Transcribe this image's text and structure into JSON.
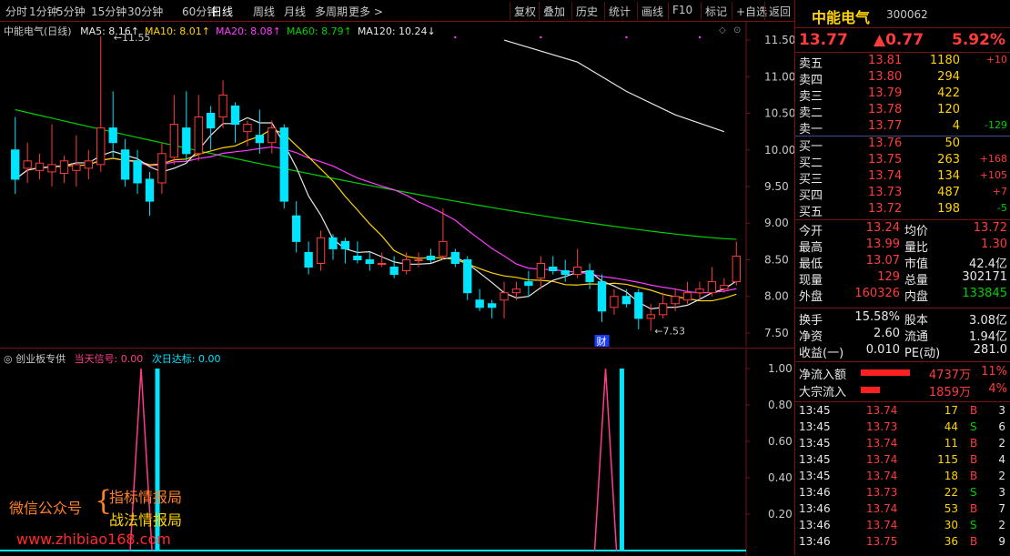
{
  "toolbar": {
    "periods": [
      "分时",
      "1分钟",
      "5分钟",
      "15分钟",
      "30分钟",
      "60分钟",
      "日线",
      "周线",
      "月线",
      "多周期",
      "更多 >"
    ],
    "active_period": "日线",
    "buttons": [
      "复权",
      "叠加",
      "历史",
      "统计",
      "画线",
      "F10",
      "标记",
      "+自选",
      "返回"
    ]
  },
  "chart": {
    "stock_title": "中能电气(日线)",
    "ma": [
      {
        "label": "MA5: 8.16",
        "arrow": "↑",
        "color": "#e8e8e8"
      },
      {
        "label": "MA10: 8.01",
        "arrow": "↑",
        "color": "#ffd400"
      },
      {
        "label": "MA20: 8.08",
        "arrow": "↑",
        "color": "#ff3cff"
      },
      {
        "label": "MA60: 8.79",
        "arrow": "↑",
        "color": "#00d000"
      },
      {
        "label": "MA120: 10.24",
        "arrow": "↓",
        "color": "#e8e8e8"
      }
    ],
    "price_axis": [
      "11.50",
      "11.00",
      "10.50",
      "10.00",
      "9.50",
      "9.00",
      "8.50",
      "8.00",
      "7.50"
    ],
    "high_mark": "11.55",
    "low_mark": "7.53",
    "event_mark": "财",
    "colors": {
      "up": "#ff3b3b",
      "down": "#00e5ff",
      "ma5": "#e8e8e8",
      "ma10": "#ffd400",
      "ma20": "#ff3cff",
      "ma60": "#00d000",
      "ma120": "#e8e8e8",
      "border": "#7a1010"
    }
  },
  "chart_data": {
    "type": "candlestick",
    "ylim": [
      7.4,
      11.6
    ],
    "candles": [
      [
        10.0,
        9.6,
        10.45,
        9.4
      ],
      [
        9.75,
        9.85,
        10.1,
        9.55
      ],
      [
        9.72,
        9.82,
        9.95,
        9.6
      ],
      [
        9.7,
        9.8,
        10.35,
        9.5
      ],
      [
        9.68,
        9.85,
        9.92,
        9.55
      ],
      [
        9.72,
        9.8,
        10.2,
        9.5
      ],
      [
        9.75,
        9.85,
        10.0,
        9.6
      ],
      [
        9.8,
        10.3,
        11.55,
        9.7
      ],
      [
        10.3,
        10.1,
        10.8,
        9.9
      ],
      [
        10.0,
        9.6,
        10.15,
        9.5
      ],
      [
        9.85,
        9.55,
        10.0,
        9.4
      ],
      [
        9.6,
        9.3,
        9.7,
        9.1
      ],
      [
        9.55,
        9.95,
        10.1,
        9.4
      ],
      [
        9.9,
        10.35,
        10.75,
        9.8
      ],
      [
        10.3,
        9.95,
        10.8,
        9.85
      ],
      [
        9.95,
        10.45,
        10.75,
        9.85
      ],
      [
        10.5,
        10.3,
        10.6,
        10.0
      ],
      [
        10.45,
        10.75,
        10.95,
        10.3
      ],
      [
        10.6,
        10.35,
        10.65,
        10.1
      ],
      [
        10.25,
        10.35,
        10.4,
        10.05
      ],
      [
        10.2,
        10.1,
        10.55,
        9.95
      ],
      [
        10.1,
        10.3,
        10.4,
        9.95
      ],
      [
        10.3,
        9.3,
        10.35,
        9.2
      ],
      [
        9.1,
        8.75,
        9.3,
        8.6
      ],
      [
        8.6,
        8.4,
        8.75,
        8.3
      ],
      [
        8.45,
        8.8,
        8.9,
        8.35
      ],
      [
        8.8,
        8.65,
        8.85,
        8.5
      ],
      [
        8.75,
        8.65,
        8.8,
        8.45
      ],
      [
        8.55,
        8.5,
        8.75,
        8.45
      ],
      [
        8.5,
        8.45,
        8.6,
        8.35
      ],
      [
        8.45,
        8.45,
        8.6,
        8.4
      ],
      [
        8.4,
        8.3,
        8.55,
        8.25
      ],
      [
        8.35,
        8.5,
        8.6,
        8.3
      ],
      [
        8.5,
        8.5,
        8.6,
        8.4
      ],
      [
        8.55,
        8.5,
        8.65,
        8.45
      ],
      [
        8.55,
        8.75,
        9.2,
        8.5
      ],
      [
        8.6,
        8.45,
        8.65,
        8.4
      ],
      [
        8.5,
        8.05,
        8.55,
        7.95
      ],
      [
        7.95,
        7.85,
        8.1,
        7.8
      ],
      [
        7.9,
        7.85,
        7.95,
        7.7
      ],
      [
        7.95,
        8.05,
        8.2,
        7.7
      ],
      [
        8.05,
        8.1,
        8.2,
        7.95
      ],
      [
        8.2,
        8.15,
        8.35,
        8.0
      ],
      [
        8.25,
        8.45,
        8.55,
        8.1
      ],
      [
        8.4,
        8.35,
        8.55,
        8.3
      ],
      [
        8.35,
        8.3,
        8.5,
        8.2
      ],
      [
        8.3,
        8.4,
        8.65,
        8.25
      ],
      [
        8.35,
        8.2,
        8.45,
        8.1
      ],
      [
        8.2,
        7.8,
        8.3,
        7.65
      ],
      [
        7.85,
        8.0,
        8.1,
        7.75
      ],
      [
        8.0,
        7.9,
        8.1,
        7.85
      ],
      [
        8.05,
        7.7,
        8.1,
        7.55
      ],
      [
        7.7,
        7.75,
        7.9,
        7.53
      ],
      [
        7.75,
        7.9,
        8.05,
        7.7
      ],
      [
        7.9,
        8.0,
        8.1,
        7.8
      ],
      [
        7.95,
        8.05,
        8.2,
        7.9
      ],
      [
        8.05,
        8.1,
        8.2,
        7.95
      ],
      [
        8.05,
        8.2,
        8.4,
        8.0
      ],
      [
        8.1,
        8.15,
        8.25,
        8.05
      ],
      [
        8.2,
        8.55,
        8.75,
        8.15
      ]
    ],
    "ma120": [
      [
        40,
        11.5
      ],
      [
        46,
        11.2
      ],
      [
        50,
        10.8
      ],
      [
        54,
        10.48
      ],
      [
        58,
        10.25
      ]
    ]
  },
  "indicator": {
    "name": "创业板专供",
    "signal_label": "当天信号: 0.00",
    "target_label": "次日达标: 0.00",
    "axis": [
      "1.00",
      "0.80",
      "0.60",
      "0.40",
      "0.20"
    ],
    "signal_spikes": [
      10,
      48
    ],
    "target_bars": [
      11,
      49
    ],
    "signal_color": "#ff3c8c",
    "target_color": "#00e5ff"
  },
  "watermark": {
    "left": "微信公众号",
    "right1": "指标情报局",
    "right2": "战法情报局",
    "url": "www.zhibiao168.com"
  },
  "quote": {
    "name": "中能电气",
    "code": "300062",
    "price": "13.77",
    "change": "▲0.77",
    "pct": "5.92%",
    "sells": [
      {
        "label": "卖五",
        "price": "13.81",
        "vol": "1180",
        "chg": "+10",
        "chg_color": "red"
      },
      {
        "label": "卖四",
        "price": "13.80",
        "vol": "294",
        "chg": "",
        "chg_color": "red"
      },
      {
        "label": "卖三",
        "price": "13.79",
        "vol": "422",
        "chg": "",
        "chg_color": "red"
      },
      {
        "label": "卖二",
        "price": "13.78",
        "vol": "120",
        "chg": "",
        "chg_color": "red"
      },
      {
        "label": "卖一",
        "price": "13.77",
        "vol": "4",
        "chg": "-129",
        "chg_color": "green"
      }
    ],
    "buys": [
      {
        "label": "买一",
        "price": "13.76",
        "vol": "50",
        "chg": "",
        "chg_color": "red"
      },
      {
        "label": "买二",
        "price": "13.75",
        "vol": "263",
        "chg": "+168",
        "chg_color": "red"
      },
      {
        "label": "买三",
        "price": "13.74",
        "vol": "134",
        "chg": "+105",
        "chg_color": "red"
      },
      {
        "label": "买四",
        "price": "13.73",
        "vol": "487",
        "chg": "+7",
        "chg_color": "red"
      },
      {
        "label": "买五",
        "price": "13.72",
        "vol": "198",
        "chg": "-5",
        "chg_color": "green"
      }
    ],
    "stats": [
      {
        "l1": "今开",
        "v1": "13.24",
        "c1": "red",
        "l2": "均价",
        "v2": "13.72",
        "c2": "red"
      },
      {
        "l1": "最高",
        "v1": "13.99",
        "c1": "red",
        "l2": "量比",
        "v2": "1.30",
        "c2": "red"
      },
      {
        "l1": "最低",
        "v1": "13.07",
        "c1": "red",
        "l2": "市值",
        "v2": "42.4亿",
        "c2": "white"
      },
      {
        "l1": "现量",
        "v1": "129",
        "c1": "red",
        "l2": "总量",
        "v2": "302171",
        "c2": "white"
      },
      {
        "l1": "外盘",
        "v1": "160326",
        "c1": "red",
        "l2": "内盘",
        "v2": "133845",
        "c2": "green"
      }
    ],
    "fund": [
      {
        "l1": "换手",
        "v1": "15.58%",
        "l2": "股本",
        "v2": "3.08亿"
      },
      {
        "l1": "净资",
        "v1": "2.60",
        "l2": "流通",
        "v2": "1.94亿"
      },
      {
        "l1": "收益(一)",
        "v1": "0.010",
        "l2": "PE(动)",
        "v2": "281.0"
      }
    ],
    "flows": [
      {
        "label": "净流入额",
        "value": "4737万",
        "pct": "11%",
        "bar": 1.0
      },
      {
        "label": "大宗流入",
        "value": "1859万",
        "pct": "4%",
        "bar": 0.39
      }
    ],
    "ticks": [
      {
        "t": "13:45",
        "p": "13.74",
        "v": "17",
        "s": "B",
        "n": "3"
      },
      {
        "t": "13:45",
        "p": "13.73",
        "v": "44",
        "s": "S",
        "n": "6"
      },
      {
        "t": "13:45",
        "p": "13.74",
        "v": "11",
        "s": "B",
        "n": "2"
      },
      {
        "t": "13:45",
        "p": "13.74",
        "v": "115",
        "s": "B",
        "n": "4"
      },
      {
        "t": "13:45",
        "p": "13.74",
        "v": "18",
        "s": "B",
        "n": "2"
      },
      {
        "t": "13:46",
        "p": "13.73",
        "v": "22",
        "s": "S",
        "n": "3"
      },
      {
        "t": "13:46",
        "p": "13.74",
        "v": "53",
        "s": "B",
        "n": "7"
      },
      {
        "t": "13:46",
        "p": "13.74",
        "v": "30",
        "s": "S",
        "n": "2"
      },
      {
        "t": "13:46",
        "p": "13.75",
        "v": "36",
        "s": "B",
        "n": "9"
      }
    ]
  }
}
